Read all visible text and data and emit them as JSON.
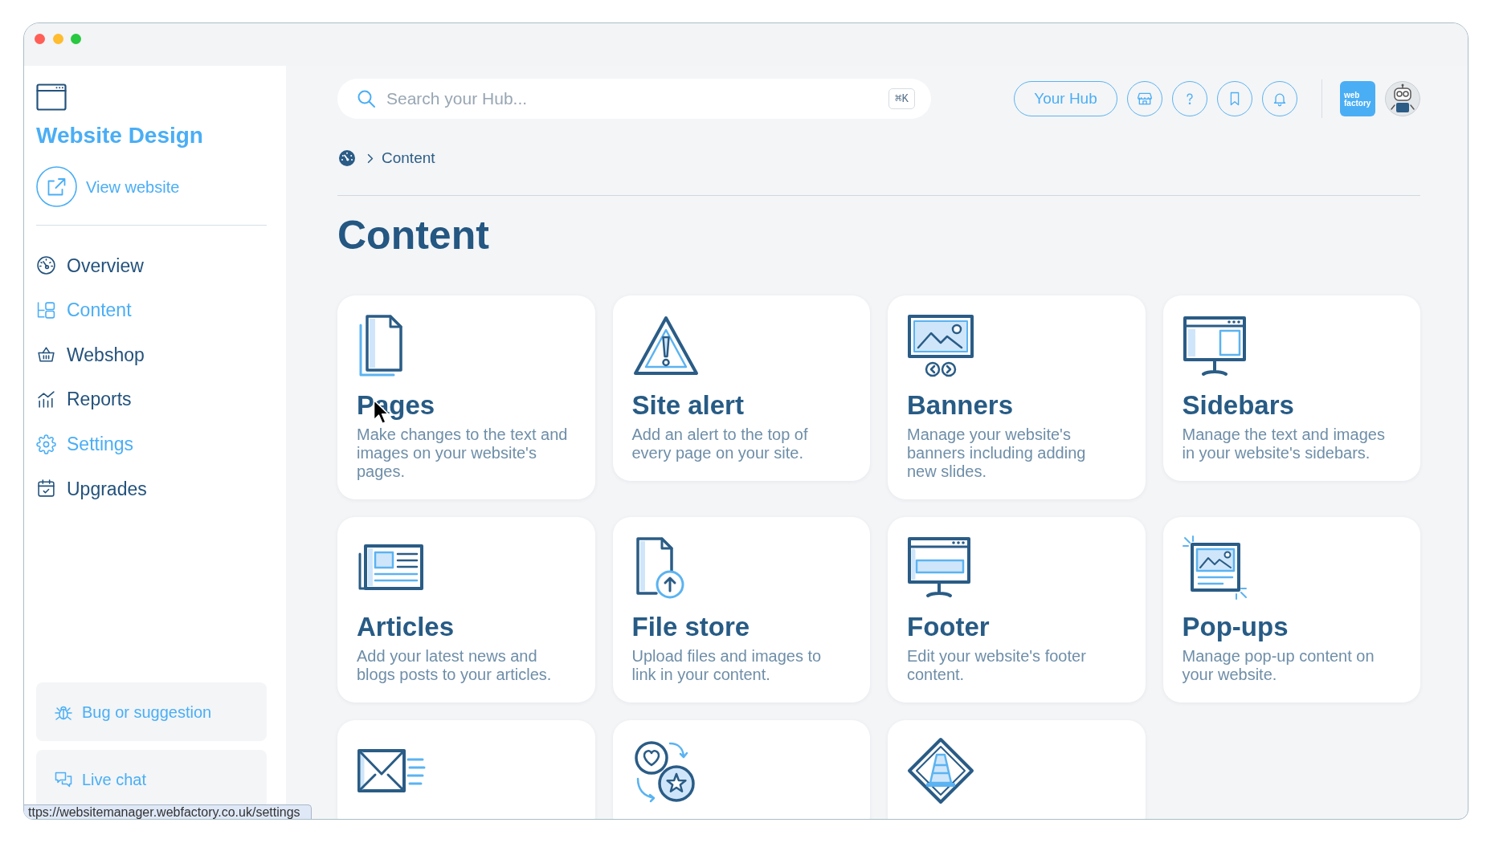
{
  "window": {
    "status_url": "ttps://websitemanager.webfactory.co.uk/settings"
  },
  "sidebar": {
    "title": "Website Design",
    "view_link": "View website",
    "nav": [
      {
        "label": "Overview",
        "kind": "gauge",
        "selected": false
      },
      {
        "label": "Content",
        "kind": "folders",
        "selected": true
      },
      {
        "label": "Webshop",
        "kind": "basket",
        "selected": false
      },
      {
        "label": "Reports",
        "kind": "chart",
        "selected": false
      },
      {
        "label": "Settings",
        "kind": "gear",
        "selected": true
      },
      {
        "label": "Upgrades",
        "kind": "calendar",
        "selected": false
      }
    ],
    "help_buttons": [
      {
        "label": "Bug or suggestion",
        "kind": "bug"
      },
      {
        "label": "Live chat",
        "kind": "chat"
      }
    ]
  },
  "topbar": {
    "search": {
      "placeholder": "Search your Hub...",
      "shortcut": "⌘K"
    },
    "hub_button": "Your Hub",
    "logo": "web factory"
  },
  "breadcrumb": [
    "Content"
  ],
  "page_title": "Content",
  "cards": [
    {
      "kind": "document",
      "title": "Pages",
      "description": "Make changes to the text and\nimages on your website's\npages.",
      "hovered": true
    },
    {
      "kind": "alert",
      "title": "Site alert",
      "description": "Add an alert to the top of\nevery page on your site.",
      "hovered": false
    },
    {
      "kind": "banner",
      "title": "Banners",
      "description": "Manage your website's\nbanners including adding\nnew slides.",
      "hovered": false
    },
    {
      "kind": "sidebar",
      "title": "Sidebars",
      "description": "Manage the text and images\nin your website's sidebars.",
      "hovered": false
    },
    {
      "kind": "newspaper",
      "title": "Articles",
      "description": "Add your latest news and\nblogs posts to your articles.",
      "hovered": false
    },
    {
      "kind": "upload",
      "title": "File store",
      "description": "Upload files and images to\nlink in your content.",
      "hovered": false
    },
    {
      "kind": "footer",
      "title": "Footer",
      "description": "Edit your website's footer\ncontent.",
      "hovered": false
    },
    {
      "kind": "popup",
      "title": "Pop-ups",
      "description": "Manage pop-up content on\nyour website.",
      "hovered": false
    },
    {
      "kind": "envelope",
      "hovered": false
    },
    {
      "kind": "hearts",
      "hovered": false
    },
    {
      "kind": "cone",
      "hovered": false
    }
  ]
}
